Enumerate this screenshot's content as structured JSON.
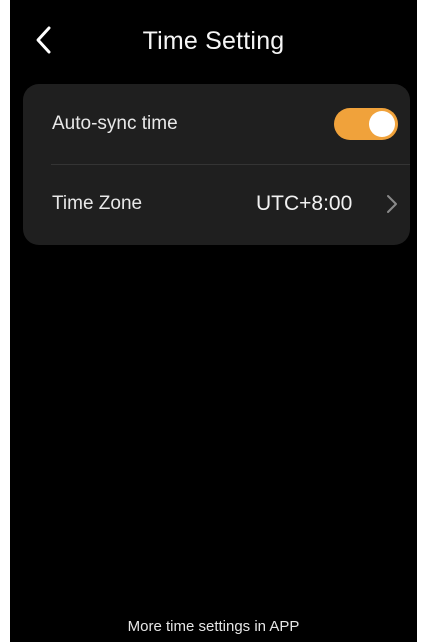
{
  "header": {
    "title": "Time Setting",
    "back_icon": "chevron-left-icon"
  },
  "settings": {
    "auto_sync": {
      "label": "Auto-sync time",
      "enabled": true,
      "toggle_color": "#f0a23b"
    },
    "time_zone": {
      "label": "Time Zone",
      "value": "UTC+8:00",
      "chevron_icon": "chevron-right-icon"
    }
  },
  "footer": {
    "note": "More time settings in APP"
  },
  "colors": {
    "background": "#000000",
    "card": "#1f1f1f",
    "accent": "#f0a23b",
    "text": "#ffffff"
  }
}
